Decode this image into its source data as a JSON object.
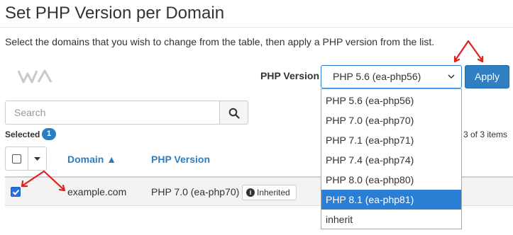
{
  "page": {
    "title": "Set PHP Version per Domain",
    "intro": "Select the domains that you wish to change from the table, then apply a PHP version from the list."
  },
  "toolbar": {
    "php_version_label": "PHP Version",
    "selected_version": "PHP 5.6 (ea-php56)",
    "apply_label": "Apply"
  },
  "search": {
    "placeholder": "Search"
  },
  "selection": {
    "label": "Selected",
    "count": "1"
  },
  "pagination": {
    "items_text": "3 of 3 items"
  },
  "table": {
    "columns": [
      "Domain ▲",
      "PHP Version"
    ],
    "rows": [
      {
        "domain": "example.com",
        "php_version": "PHP 7.0 (ea-php70)",
        "badge": "Inherited",
        "checked": true
      }
    ]
  },
  "dropdown": {
    "options": [
      "PHP 5.6 (ea-php56)",
      "PHP 7.0 (ea-php70)",
      "PHP 7.1 (ea-php71)",
      "PHP 7.4 (ea-php74)",
      "PHP 8.0 (ea-php80)",
      "PHP 8.1 (ea-php81)",
      "inherit"
    ],
    "highlighted": "PHP 8.1 (ea-php81)"
  },
  "colors": {
    "accent": "#2a7fc4",
    "select_highlight": "#2a7fd4",
    "annotation_arrow": "#e0201b"
  },
  "icons": {
    "logo": "wa-logo-icon",
    "search": "search-icon",
    "chevron": "chevron-down-icon",
    "caret": "caret-down-icon",
    "info": "info-icon",
    "check": "check-icon",
    "arrow": "red-annotation-arrow"
  }
}
